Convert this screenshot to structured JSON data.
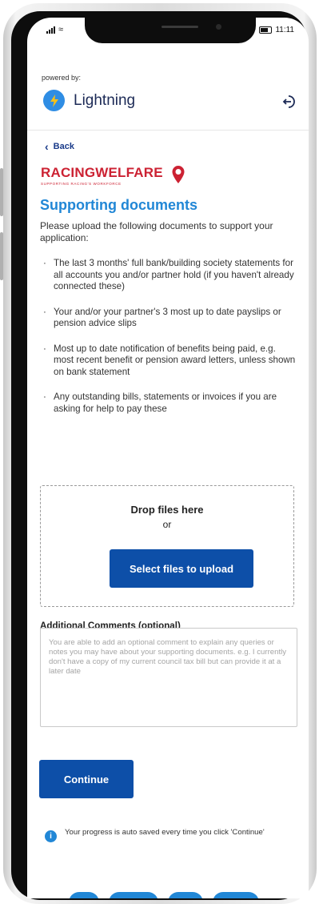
{
  "status_bar": {
    "time": "11:11"
  },
  "header": {
    "powered_by": "powered by:",
    "brand_name": "Lightning",
    "logout_icon": "logout-icon",
    "lightning_icon": "lightning-bolt-icon"
  },
  "back_label": "Back",
  "partner": {
    "name": "RACINGWELFARE",
    "tagline": "SUPPORTING RACING'S WORKFORCE"
  },
  "page": {
    "title": "Supporting documents",
    "intro": "Please upload the following documents to support your application:",
    "documents": [
      "The last 3 months' full bank/building society statements for all accounts you and/or partner hold (if you haven't already connected these)",
      "Your and/or your partner's 3 most up to date payslips or pension advice slips",
      "Most up to date notification of benefits being paid, e.g. most recent benefit or pension award letters, unless shown on bank statement",
      "Any outstanding bills, statements or invoices if you are asking for help to pay these"
    ]
  },
  "upload": {
    "drop_line1": "Drop files here",
    "drop_line2": "or",
    "select_label": "Select files to upload"
  },
  "comments": {
    "label": "Additional Comments (optional)",
    "placeholder": "You are able to add an optional comment to explain any queries or notes you may have about your supporting documents. e.g. I currently don't have a copy of my current council tax bill but can provide it at a later date",
    "value": ""
  },
  "continue_label": "Continue",
  "info_note": "Your progress is auto saved every time you click 'Continue'",
  "colors": {
    "primary": "#0d4fa8",
    "accent": "#2187d6",
    "partner_red": "#cc2233"
  }
}
